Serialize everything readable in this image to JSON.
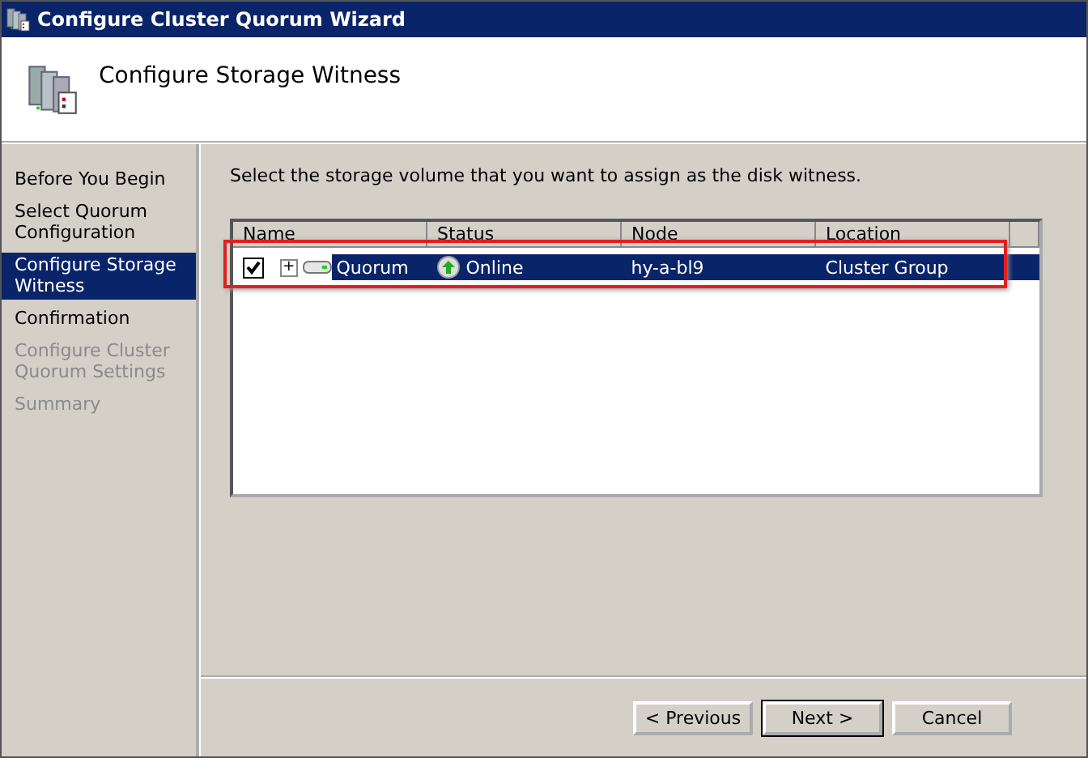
{
  "window": {
    "title": "Configure Cluster Quorum Wizard"
  },
  "header": {
    "title": "Configure Storage Witness"
  },
  "steps": [
    {
      "label": "Before You Begin",
      "selected": false,
      "disabled": false
    },
    {
      "label": "Select Quorum Configuration",
      "selected": false,
      "disabled": false
    },
    {
      "label": "Configure Storage Witness",
      "selected": true,
      "disabled": false
    },
    {
      "label": "Confirmation",
      "selected": false,
      "disabled": false
    },
    {
      "label": "Configure Cluster Quorum Settings",
      "selected": false,
      "disabled": true
    },
    {
      "label": "Summary",
      "selected": false,
      "disabled": true
    }
  ],
  "instruction": "Select the storage volume that you want to assign as the disk witness.",
  "table": {
    "columns": [
      "Name",
      "Status",
      "Node",
      "Location"
    ],
    "rows": [
      {
        "name": "Quorum",
        "status": "Online",
        "node": "hy-a-bl9",
        "location": "Cluster Group",
        "checked": true,
        "selected": true,
        "expander": "+"
      }
    ]
  },
  "buttons": [
    "< Previous",
    "Next >",
    "Cancel"
  ]
}
